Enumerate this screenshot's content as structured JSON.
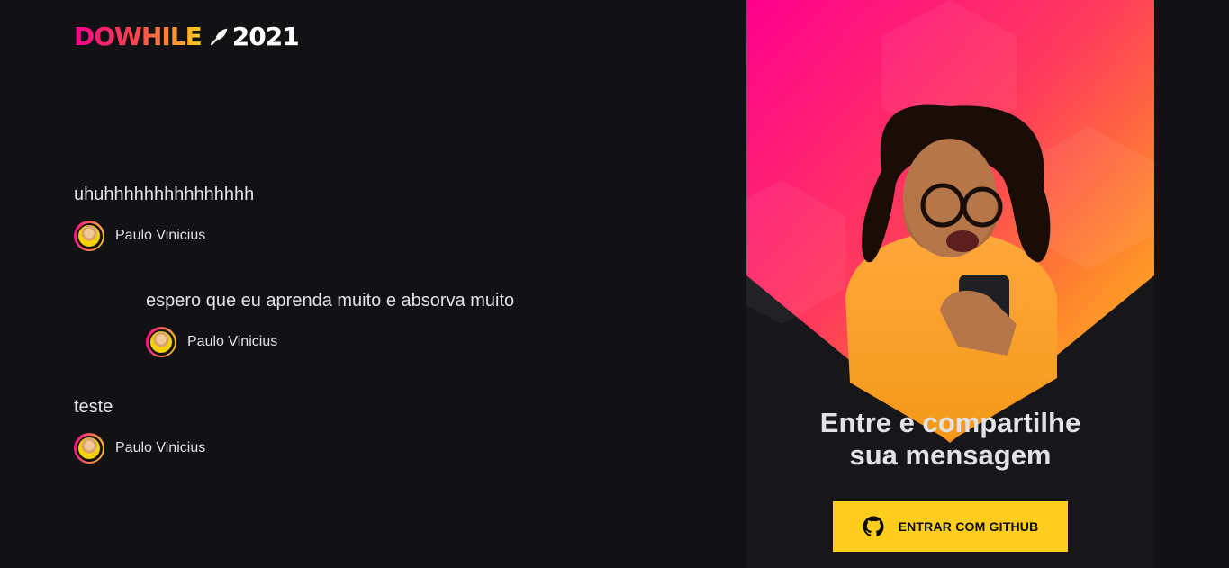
{
  "header": {
    "logo_text": "DOWHILE",
    "logo_year": "2021"
  },
  "messages": [
    {
      "text": "uhuhhhhhhhhhhhhhhh",
      "author": "Paulo Vinicius"
    },
    {
      "text": "espero que eu aprenda muito e absorva muito",
      "author": "Paulo Vinicius"
    },
    {
      "text": "teste",
      "author": "Paulo Vinicius"
    }
  ],
  "login": {
    "title_line1": "Entre e compartilhe",
    "title_line2": "sua mensagem",
    "button_label": "ENTRAR COM GITHUB",
    "button_icon": "github-icon"
  },
  "colors": {
    "background": "#121214",
    "pink": "#ff008e",
    "yellow": "#ffcd1e",
    "text": "#e1e1e6"
  }
}
